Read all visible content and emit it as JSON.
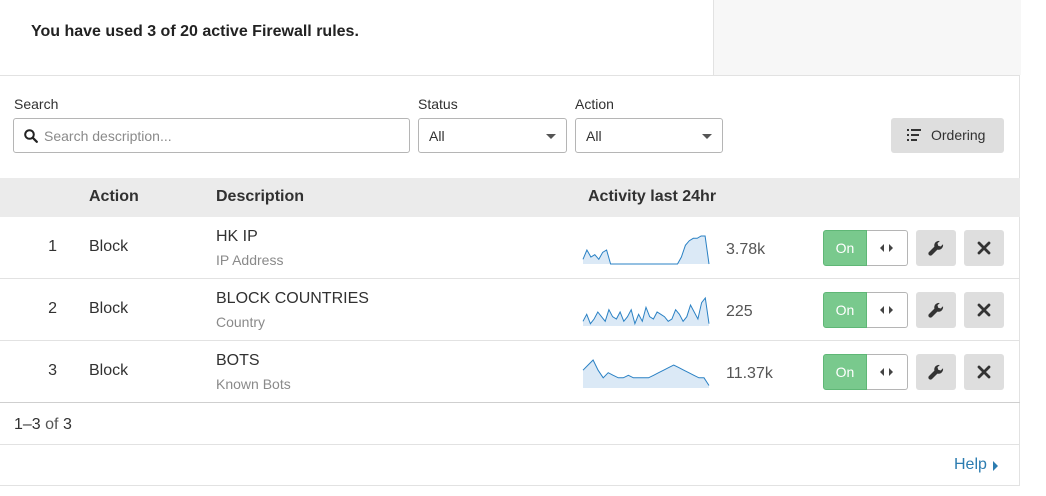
{
  "usage": {
    "prefix": "You have used",
    "used": "3",
    "of_word": "of",
    "limit": "20",
    "suffix": "active Firewall rules."
  },
  "filters": {
    "search_label": "Search",
    "search_placeholder": "Search description...",
    "search_value": "",
    "status_label": "Status",
    "status_value": "All",
    "action_label": "Action",
    "action_value": "All",
    "ordering_label": "Ordering"
  },
  "table": {
    "headers": {
      "action": "Action",
      "description": "Description",
      "activity": "Activity last 24hr"
    },
    "rows": [
      {
        "priority": "1",
        "action": "Block",
        "description": "HK IP",
        "type": "IP Address",
        "activity_count": "3.78k",
        "toggle_label": "On",
        "enabled": true,
        "activity": [
          2,
          6,
          3,
          4,
          2,
          5,
          6,
          0,
          0,
          0,
          0,
          0,
          0,
          0,
          0,
          0,
          0,
          0,
          0,
          0,
          0,
          0,
          0,
          0,
          0,
          3,
          8,
          10,
          11,
          11,
          12,
          12,
          0
        ]
      },
      {
        "priority": "2",
        "action": "Block",
        "description": "BLOCK COUNTRIES",
        "type": "Country",
        "activity_count": "225",
        "toggle_label": "On",
        "enabled": true,
        "activity": [
          2,
          5,
          1,
          3,
          6,
          4,
          2,
          7,
          4,
          3,
          6,
          2,
          4,
          7,
          1,
          5,
          2,
          8,
          4,
          3,
          6,
          5,
          4,
          2,
          3,
          7,
          5,
          2,
          4,
          9,
          6,
          3,
          10,
          12,
          1
        ]
      },
      {
        "priority": "3",
        "action": "Block",
        "description": "BOTS",
        "type": "Known Bots",
        "activity_count": "11.37k",
        "toggle_label": "On",
        "enabled": true,
        "activity": [
          7,
          9,
          11,
          7,
          4,
          6,
          5,
          4,
          4,
          5,
          4,
          4,
          4,
          4,
          5,
          6,
          7,
          8,
          9,
          8,
          7,
          6,
          5,
          4,
          4,
          1
        ]
      }
    ]
  },
  "pager": {
    "range": "1–3",
    "of_word": "of",
    "total": "3"
  },
  "footer": {
    "help_label": "Help"
  },
  "colors": {
    "accent": "#2c7cb0",
    "toggle_on": "#79c98d",
    "spark_line": "#2a81c4",
    "spark_fill": "#dbe9f6"
  },
  "icons": {
    "search": "search-icon",
    "ordering": "list-icon",
    "drag": "drag-handle-icon",
    "edit": "wrench-icon",
    "delete": "close-icon",
    "help": "caret-right-icon"
  }
}
